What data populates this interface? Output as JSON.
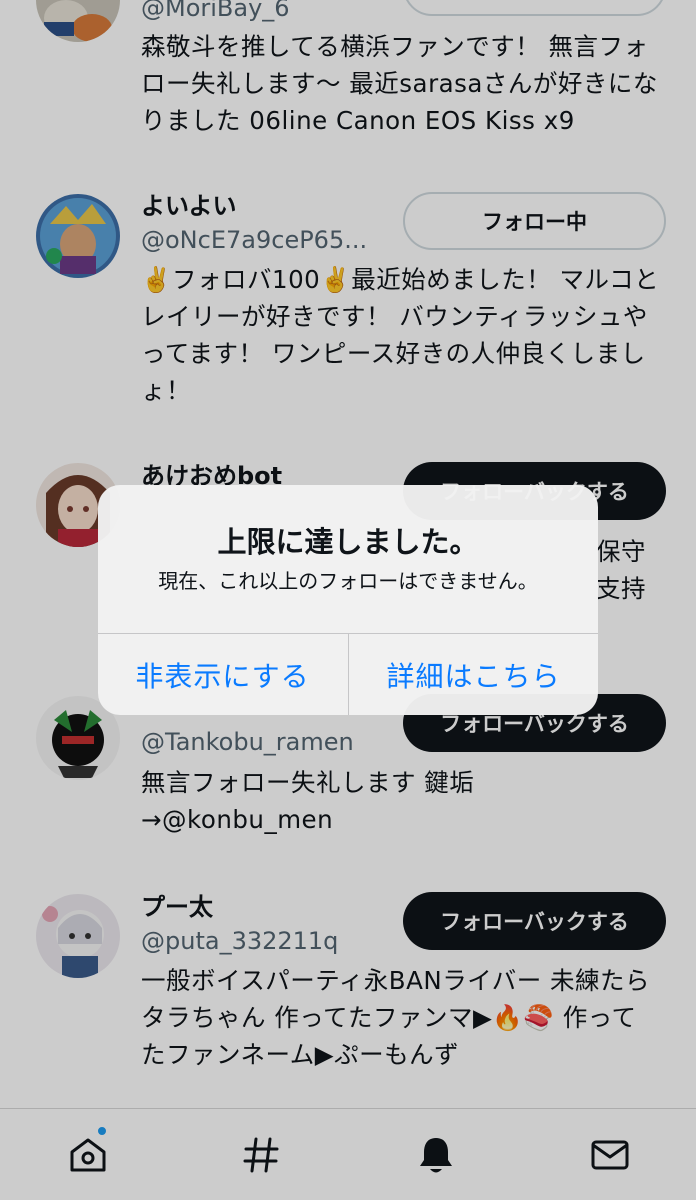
{
  "users": [
    {
      "name": "",
      "handle": "@MoriBay_6",
      "bio": "森敬斗を推してる横浜ファンです！ 無言フォロー失礼します〜 最近sarasaさんが好きになりました 06line Canon EOS Kiss x9",
      "button": ""
    },
    {
      "name": "よいよい",
      "handle": "@oNcE7a9ceP65...",
      "bio": "✌️フォロバ100✌️最近始めました！ マルコとレイリーが好きです！ バウンティラッシュやってます！ ワンピース好きの人仲良くしましょ！",
      "button": "フォロー中"
    },
    {
      "name": "あけおめbot",
      "handle": "",
      "bio": "保守 支持",
      "button": "フォローバックする"
    },
    {
      "name": "",
      "handle": "@Tankobu_ramen",
      "bio": "無言フォロー失礼します 鍵垢 →@konbu_men",
      "button": "フォローバックする"
    },
    {
      "name": "プー太",
      "handle": "@puta_332211q",
      "bio": "一般ボイスパーティ永BANライバー 未練たらタラちゃん 作ってたファンマ▶🔥🍣 作ってたファンネーム▶ぷーもんず",
      "button": "フォローバックする"
    }
  ],
  "alert": {
    "title": "上限に達しました。",
    "message": "現在、これ以上のフォローはできません。",
    "dismiss_label": "非表示にする",
    "details_label": "詳細はこちら"
  },
  "tabbar": {
    "icons": [
      "home-icon",
      "hashtag-icon",
      "bell-icon",
      "mail-icon"
    ]
  },
  "colors": {
    "accent": "#0a7bff",
    "badge": "#1d9bf0",
    "button_dark": "#0f1419"
  }
}
